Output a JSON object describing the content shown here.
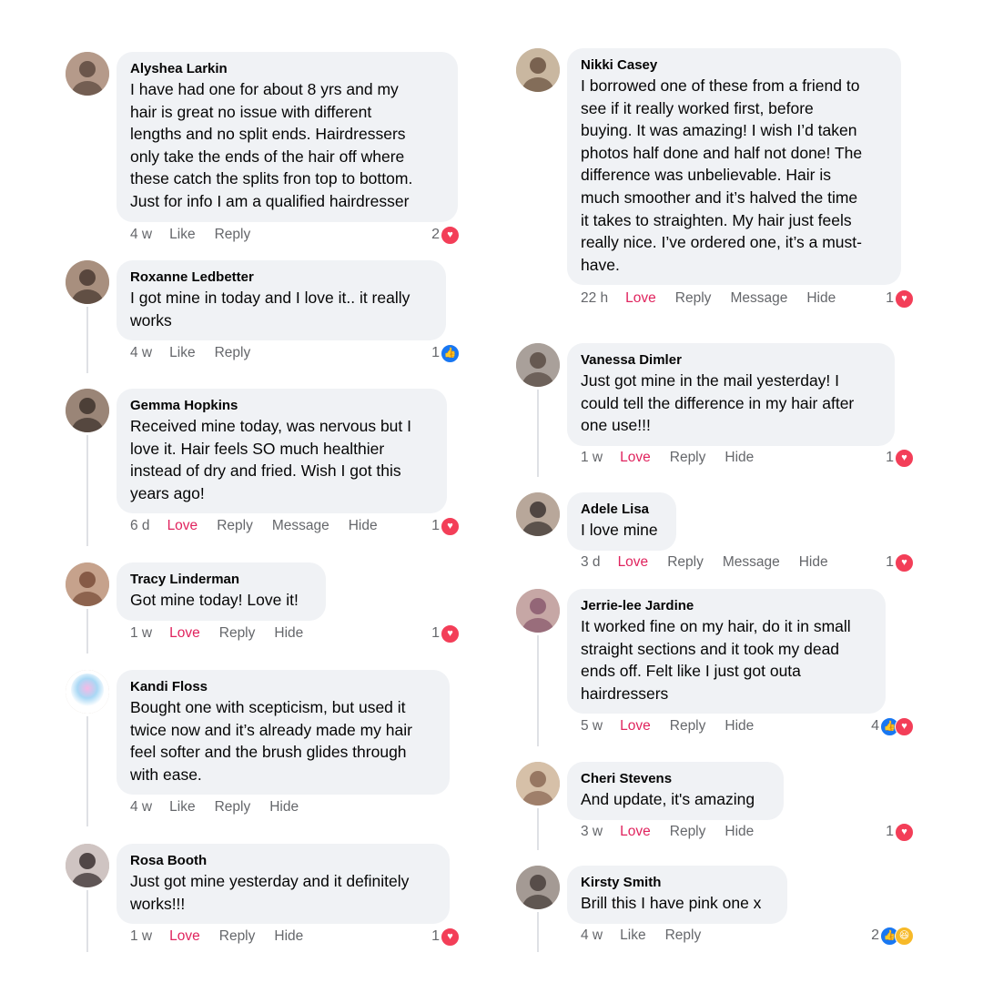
{
  "icons": {
    "heart": "♥",
    "like": "👍",
    "haha": "😆"
  },
  "colors": {
    "love": "#e0245e",
    "heart_badge": "#f33e58",
    "like_badge": "#1877f2",
    "haha_badge": "#f7b928",
    "bubble": "#f0f2f5",
    "meta": "#65676b"
  },
  "left": [
    {
      "author": "Alyshea Larkin",
      "text": "I have had one for about 8 yrs and my\nhair is great no issue with different\nlengths and no split ends. Hairdressers\nonly take the ends of the hair off where\nthese catch the splits fron top to bottom.\nJust for info I am a qualified hairdresser",
      "time": "4 w",
      "actions": [
        "Like",
        "Reply"
      ],
      "reaction_count": "2",
      "reactions": [
        "heart"
      ]
    },
    {
      "author": "Roxanne Ledbetter",
      "text": "I got mine in today and I love it.. it really\nworks",
      "time": "4 w",
      "actions": [
        "Like",
        "Reply"
      ],
      "reaction_count": "1",
      "reactions": [
        "like"
      ]
    },
    {
      "author": "Gemma Hopkins",
      "text": "Received mine today, was nervous but I\nlove it. Hair feels SO much healthier\ninstead of dry and fried. Wish I got this\nyears ago!",
      "time": "6 d",
      "actions": [
        "Love",
        "Reply",
        "Message",
        "Hide"
      ],
      "reaction_count": "1",
      "reactions": [
        "heart"
      ]
    },
    {
      "author": "Tracy Linderman",
      "text": "Got mine today! Love it!",
      "time": "1 w",
      "actions": [
        "Love",
        "Reply",
        "Hide"
      ],
      "reaction_count": "1",
      "reactions": [
        "heart"
      ]
    },
    {
      "author": "Kandi Floss",
      "text": "Bought one with scepticism, but used it\ntwice now and it’s already made my hair\nfeel softer and the brush glides through\nwith ease.",
      "time": "4 w",
      "actions": [
        "Like",
        "Reply",
        "Hide"
      ],
      "reaction_count": "",
      "reactions": []
    },
    {
      "author": "Rosa Booth",
      "text": "Just got mine yesterday and it definitely\nworks!!!",
      "time": "1 w",
      "actions": [
        "Love",
        "Reply",
        "Hide"
      ],
      "reaction_count": "1",
      "reactions": [
        "heart"
      ]
    }
  ],
  "right": [
    {
      "author": "Nikki Casey",
      "text": "I borrowed one of these from a friend to\nsee if it really worked first, before\nbuying. It was amazing! I wish I’d taken\nphotos half done and half not done! The\ndifference was unbelievable. Hair is\nmuch smoother and it’s halved the time\nit takes to straighten. My hair just feels\nreally nice. I’ve ordered one, it’s a must-\nhave.",
      "time": "22 h",
      "actions": [
        "Love",
        "Reply",
        "Message",
        "Hide"
      ],
      "reaction_count": "1",
      "reactions": [
        "heart"
      ]
    },
    {
      "author": "Vanessa Dimler",
      "text": "Just got mine in the mail yesterday! I\ncould tell the difference in my hair after\none use!!!",
      "time": "1 w",
      "actions": [
        "Love",
        "Reply",
        "Hide"
      ],
      "reaction_count": "1",
      "reactions": [
        "heart"
      ]
    },
    {
      "author": "Adele Lisa",
      "text": "I love mine",
      "time": "3 d",
      "actions": [
        "Love",
        "Reply",
        "Message",
        "Hide"
      ],
      "reaction_count": "1",
      "reactions": [
        "heart"
      ]
    },
    {
      "author": "Jerrie-lee Jardine",
      "text": "It worked fine on my hair, do it in small\nstraight sections and it took my dead\nends off. Felt like I just got outa\nhairdressers",
      "time": "5 w",
      "actions": [
        "Love",
        "Reply",
        "Hide"
      ],
      "reaction_count": "4",
      "reactions": [
        "like",
        "heart"
      ]
    },
    {
      "author": "Cheri Stevens",
      "text": "And update, it's amazing",
      "time": "3 w",
      "actions": [
        "Love",
        "Reply",
        "Hide"
      ],
      "reaction_count": "1",
      "reactions": [
        "heart"
      ]
    },
    {
      "author": "Kirsty Smith",
      "text": "Brill this I have pink one x",
      "time": "4 w",
      "actions": [
        "Like",
        "Reply"
      ],
      "reaction_count": "2",
      "reactions": [
        "like",
        "haha"
      ]
    }
  ]
}
